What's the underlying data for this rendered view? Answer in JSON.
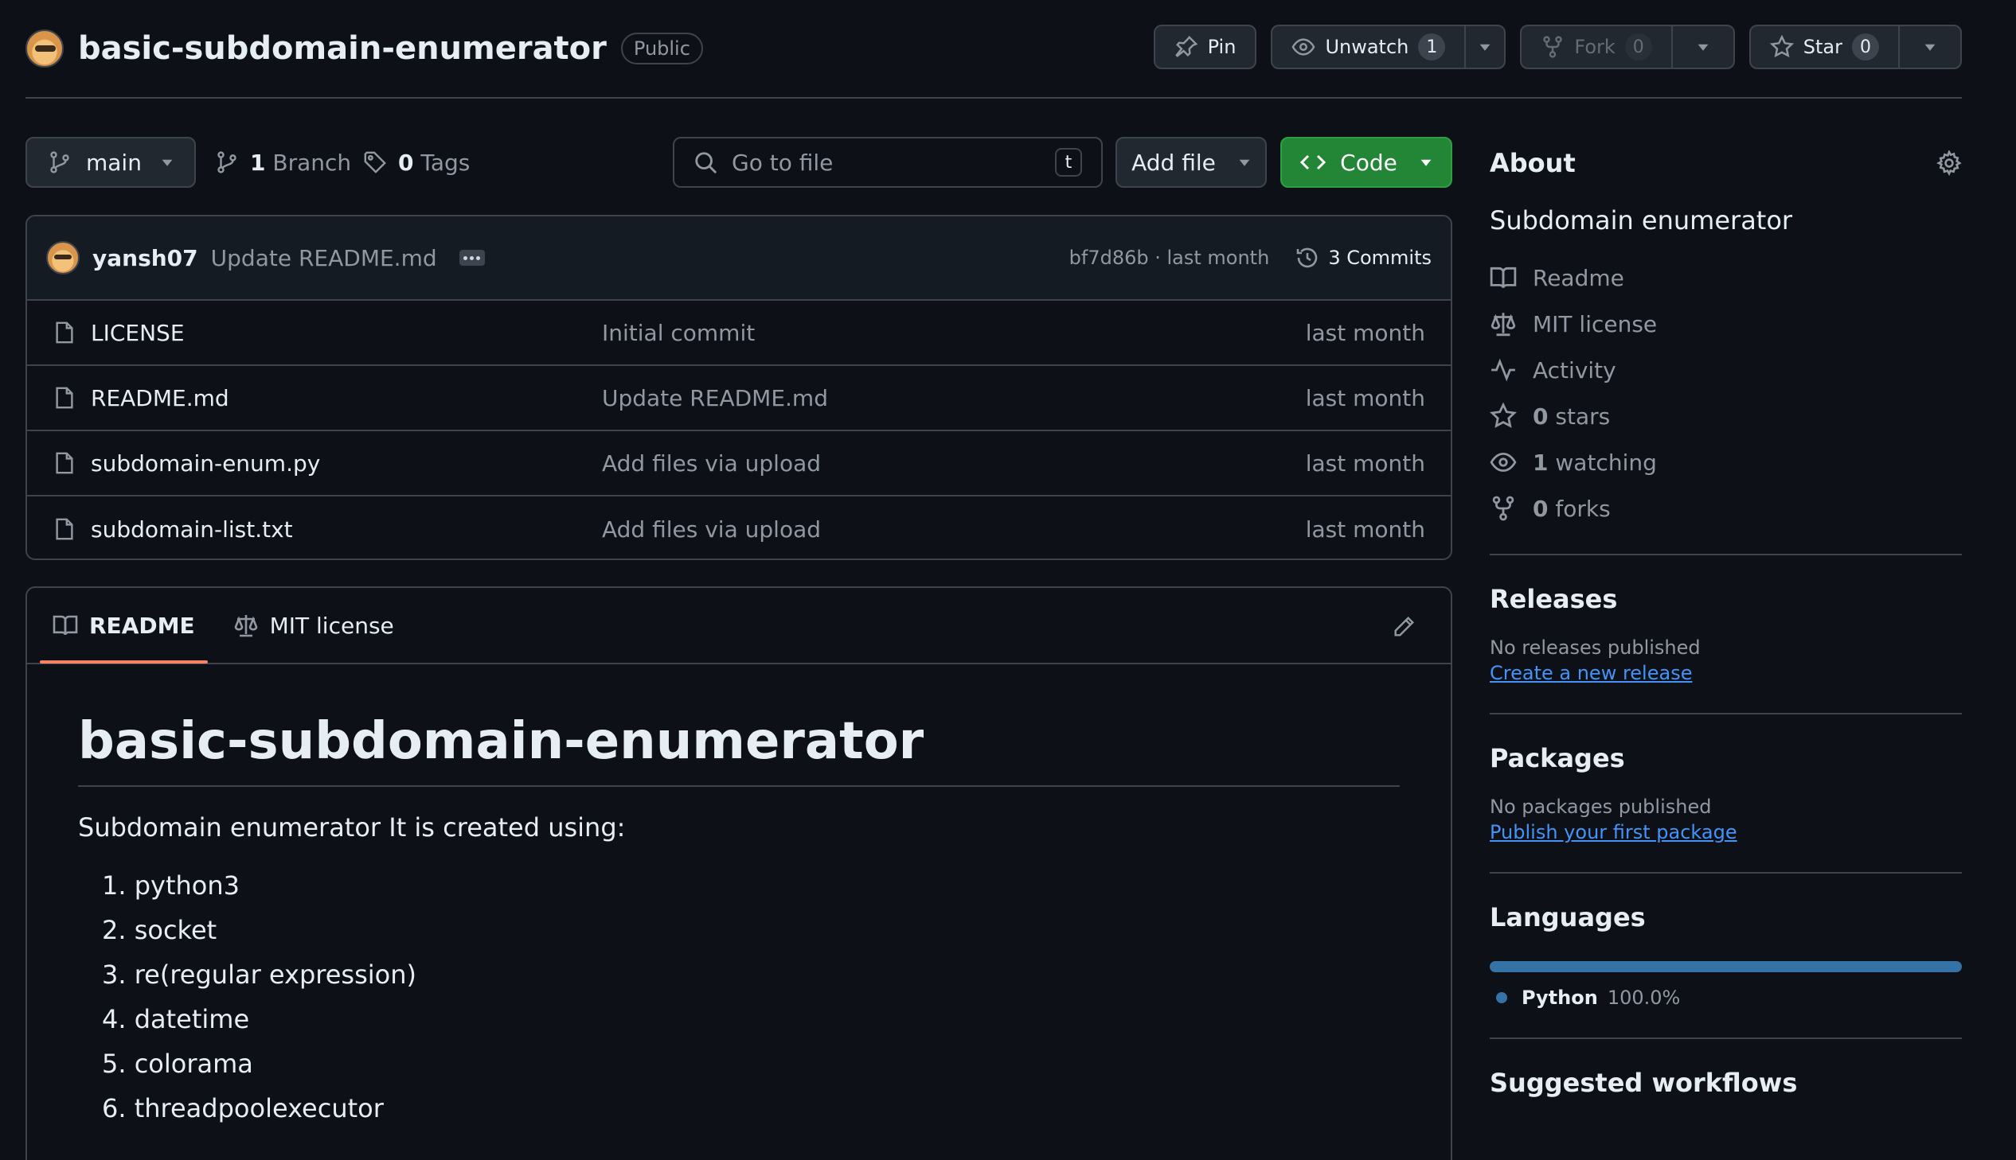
{
  "repo": {
    "name": "basic-subdomain-enumerator",
    "visibility": "Public"
  },
  "header_actions": {
    "pin_label": "Pin",
    "unwatch_label": "Unwatch",
    "watch_count": "1",
    "fork_label": "Fork",
    "fork_count": "0",
    "star_label": "Star",
    "star_count": "0"
  },
  "branch_bar": {
    "branch": "main",
    "branch_count": "1",
    "branch_label": "Branch",
    "tag_count": "0",
    "tag_label": "Tags",
    "goto_placeholder": "Go to file",
    "goto_shortcut": "t",
    "add_file_label": "Add file",
    "code_label": "Code"
  },
  "latest_commit": {
    "author": "yansh07",
    "message": "Update README.md",
    "hash_time": "bf7d86b · last month",
    "commits_label": "3 Commits"
  },
  "files": [
    {
      "name": "LICENSE",
      "message": "Initial commit",
      "age": "last month"
    },
    {
      "name": "README.md",
      "message": "Update README.md",
      "age": "last month"
    },
    {
      "name": "subdomain-enum.py",
      "message": "Add files via upload",
      "age": "last month"
    },
    {
      "name": "subdomain-list.txt",
      "message": "Add files via upload",
      "age": "last month"
    }
  ],
  "readme": {
    "tabs": [
      "README",
      "MIT license"
    ],
    "title": "basic-subdomain-enumerator",
    "intro": "Subdomain enumerator It is created using:",
    "items": [
      "1. python3",
      "2. socket",
      "3. re(regular expression)",
      "4. datetime",
      "5. colorama",
      "6. threadpoolexecutor"
    ]
  },
  "about": {
    "heading": "About",
    "description": "Subdomain enumerator",
    "readme_label": "Readme",
    "license_label": "MIT license",
    "activity_label": "Activity",
    "stars_count": "0",
    "stars_label": "stars",
    "watching_count": "1",
    "watching_label": "watching",
    "forks_count": "0",
    "forks_label": "forks"
  },
  "releases": {
    "heading": "Releases",
    "empty": "No releases published",
    "link": "Create a new release"
  },
  "packages": {
    "heading": "Packages",
    "empty": "No packages published",
    "link": "Publish your first package"
  },
  "languages": {
    "heading": "Languages",
    "items": [
      {
        "name": "Python",
        "percent": "100.0%",
        "fraction": 1.0,
        "color": "#3572A5"
      }
    ]
  },
  "suggested": {
    "heading": "Suggested workflows"
  },
  "colors": {
    "background": "#0d1117",
    "border": "#3d444d",
    "accent_green": "#238636",
    "link_blue": "#4493f8",
    "tab_underline": "#f78166"
  }
}
